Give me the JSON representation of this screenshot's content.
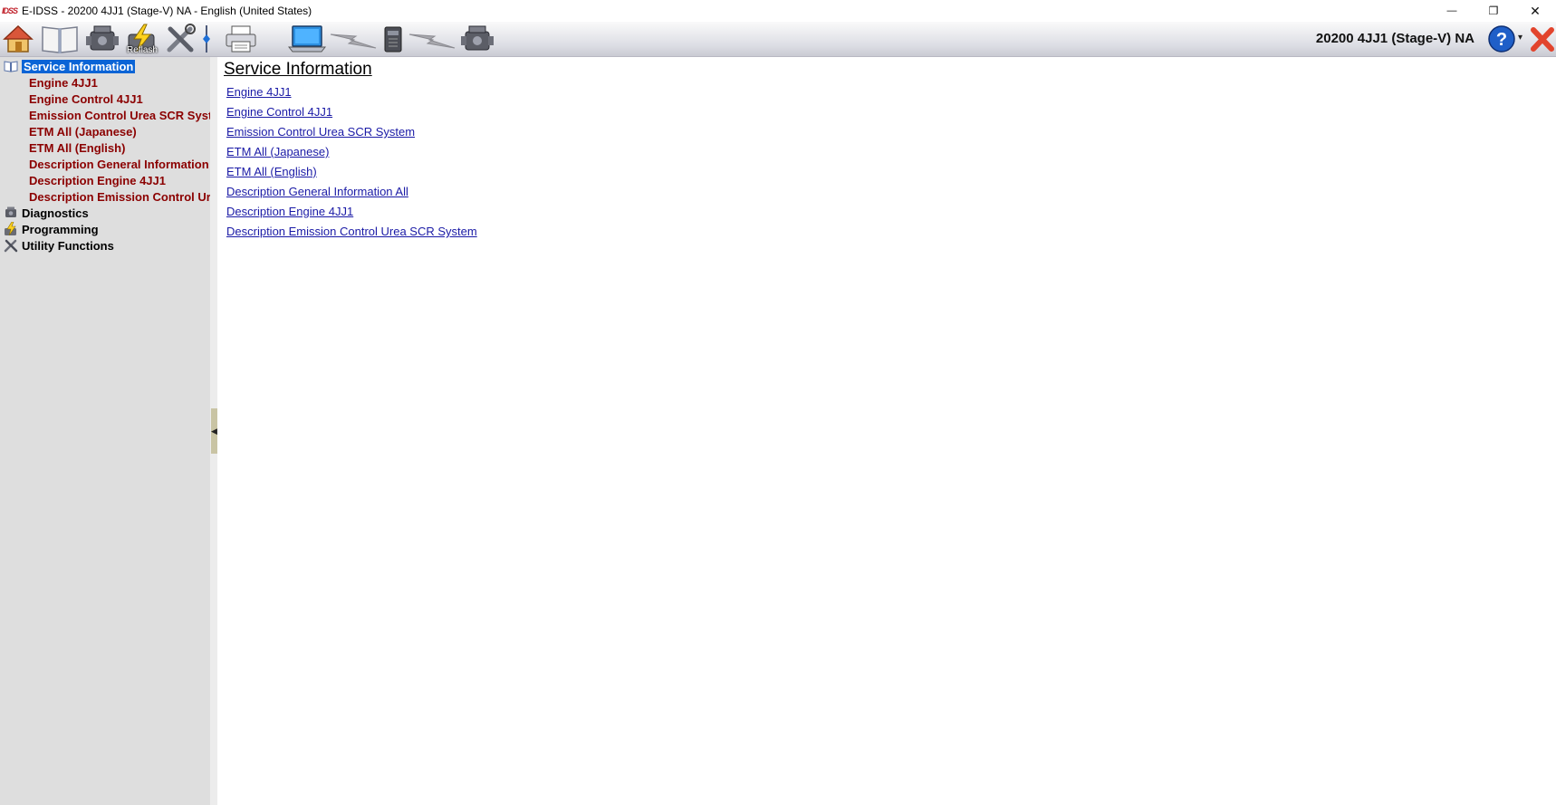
{
  "window": {
    "logo_text": "IDSS",
    "title": "E-IDSS - 20200 4JJ1 (Stage-V)  NA - English (United States)",
    "minimize": "—",
    "restore": "❐",
    "close": "✕"
  },
  "toolbar": {
    "buttons": [
      {
        "name": "home",
        "icon": "home-icon"
      },
      {
        "name": "service-information",
        "icon": "book-icon"
      },
      {
        "name": "diagnostics",
        "icon": "engine-icon"
      },
      {
        "name": "reflash",
        "icon": "lightning-engine-icon",
        "label": "Reflash"
      },
      {
        "name": "utility",
        "icon": "tools-icon"
      },
      {
        "name": "separator",
        "icon": "divider-icon"
      },
      {
        "name": "print",
        "icon": "printer-icon"
      },
      {
        "name": "laptop",
        "icon": "laptop-icon"
      },
      {
        "name": "link-1",
        "icon": "lightning-icon"
      },
      {
        "name": "interface",
        "icon": "interface-device-icon"
      },
      {
        "name": "link-2",
        "icon": "lightning-icon"
      },
      {
        "name": "engine",
        "icon": "engine-icon"
      }
    ],
    "reflash_label": "Reflash",
    "vehicle": "20200 4JJ1 (Stage-V)  NA",
    "help_caret": "▾",
    "colors": {
      "help": "#1f5fc8",
      "exit": "#e2442d"
    }
  },
  "sidebar": {
    "roots": [
      {
        "label": "Service Information",
        "icon": "book-icon",
        "selected": true
      },
      {
        "label": "Diagnostics",
        "icon": "engine-icon"
      },
      {
        "label": "Programming",
        "icon": "lightning-engine-icon"
      },
      {
        "label": "Utility Functions",
        "icon": "tools-icon"
      }
    ],
    "service_children": [
      "Engine 4JJ1",
      "Engine Control 4JJ1",
      "Emission Control Urea SCR System",
      "ETM All (Japanese)",
      "ETM All (English)",
      "Description General Information All",
      "Description Engine 4JJ1",
      "Description Emission Control Urea SCR System"
    ],
    "splitter_arrow": "◀"
  },
  "content": {
    "title": "Service Information",
    "links": [
      "Engine 4JJ1",
      "Engine Control 4JJ1",
      "Emission Control Urea SCR System",
      "ETM All (Japanese)",
      "ETM All (English)",
      "Description General Information All",
      "Description Engine 4JJ1",
      "Description Emission Control Urea SCR System"
    ]
  }
}
